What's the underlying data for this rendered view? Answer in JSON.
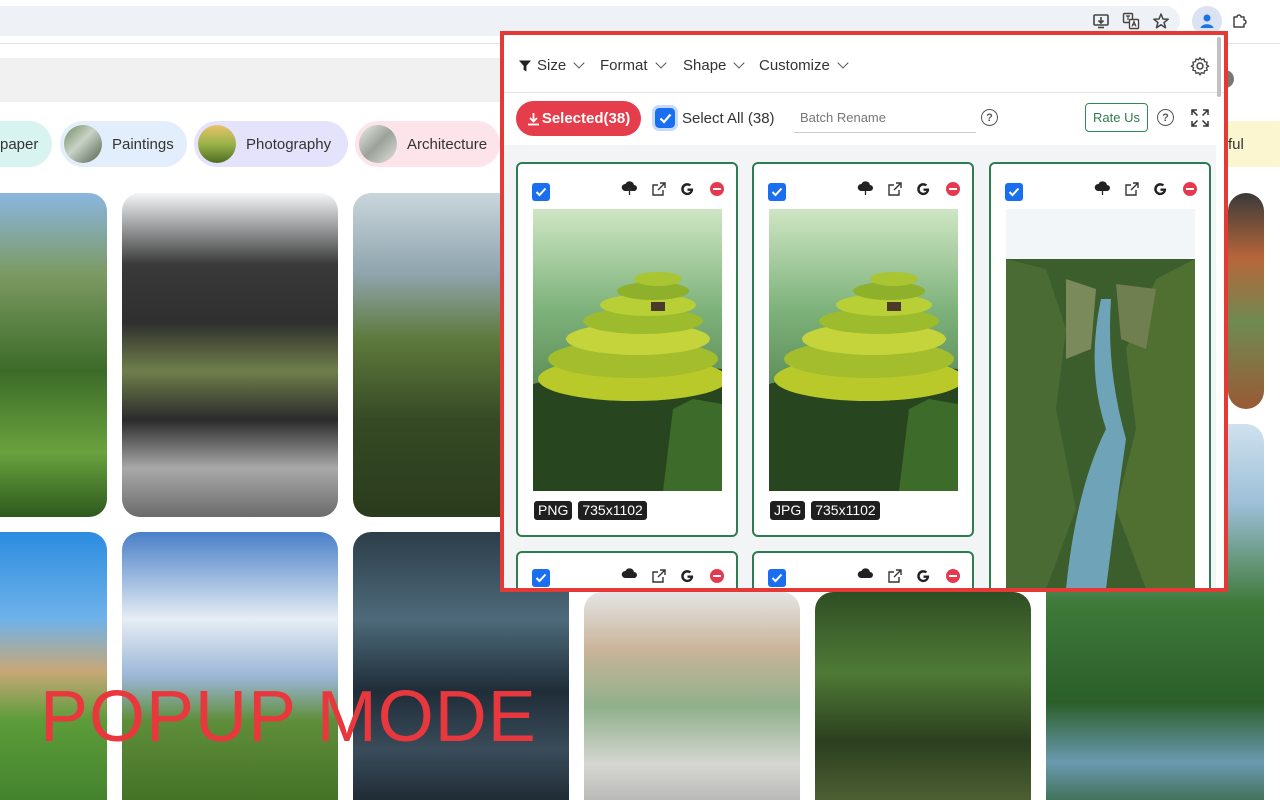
{
  "popup": {
    "menus": [
      {
        "label": "Size"
      },
      {
        "label": "Format"
      },
      {
        "label": "Shape"
      },
      {
        "label": "Customize"
      }
    ],
    "selected_button": "Selected(38)",
    "select_all_label": "Select All (38)",
    "batch_rename_placeholder": "Batch Rename",
    "rate_button": "Rate Us",
    "help_glyph": "?",
    "images": [
      {
        "format": "PNG",
        "dimensions": "735x1102"
      },
      {
        "format": "JPG",
        "dimensions": "735x1102"
      }
    ]
  },
  "page": {
    "categories": [
      {
        "label": "paper"
      },
      {
        "label": "Paintings"
      },
      {
        "label": "Photography"
      },
      {
        "label": "Architecture"
      },
      {
        "label": "ful"
      }
    ]
  },
  "overlay_text": "POPUP MODE",
  "colors": {
    "popup_border": "#e53935",
    "selected_button": "#e53d4b",
    "checkbox": "#1a6ff0",
    "card_border": "#2e7d52",
    "overlay_text": "#e8383d"
  },
  "icons": [
    "filter-icon",
    "chevron-down-icon",
    "gear-icon",
    "download-icon",
    "arrow-down-icon",
    "help-icon",
    "expand-icon",
    "cloud-download-icon",
    "open-external-icon",
    "google-icon",
    "remove-icon",
    "checkmark-icon",
    "star-icon",
    "translate-icon",
    "install-icon",
    "extension-icon",
    "profile-icon"
  ]
}
